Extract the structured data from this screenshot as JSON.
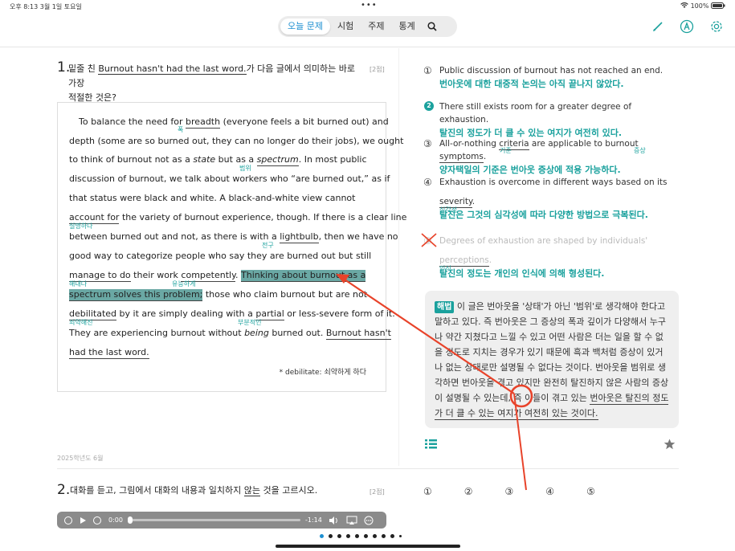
{
  "status": {
    "time": "오후 8:13   3월 1일 토요일",
    "dots": "•••",
    "battery": "100%"
  },
  "tabs": [
    "오늘 문제",
    "시험",
    "주제",
    "통계"
  ],
  "q1": {
    "num": "1.",
    "text_a": "밑줄 친 ",
    "text_u": "Burnout hasn't had the last word.",
    "text_b": "가 다음 글에서 의미하는 바로 가장",
    "text_c": "적절한 것은?",
    "points": "[2점]"
  },
  "passage": {
    "l1a": "To balance the need for ",
    "l1u": "breadth",
    "l1b": " (everyone feels a bit burned out) and",
    "g1": "폭",
    "l2": "depth (some are so burned out, they can no longer do their jobs), we ought",
    "l3a": "to think of burnout not as a ",
    "l3i": "state",
    "l3b": " but as a ",
    "l3u": "spectrum",
    "l3c": ". In most public",
    "g3": "범위",
    "l4": "discussion of burnout, we talk about workers who “are burned out,” as if",
    "l5": "that status were black and white. A black-and-white view cannot",
    "l6u": "account for",
    "l6b": " the variety of burnout experience, though. If there is a clear line",
    "g6": "설명하다",
    "l7a": "between burned out and not, as there is with a ",
    "l7u": "lightbulb",
    "l7b": ", then we have no",
    "g7": "전구",
    "l8": "good way to categorize people who say they are burned out but still",
    "l9u": "manage to do",
    "l9b": " their work ",
    "l9u2": "competently",
    "l9c": ". ",
    "l9h": "Thinking about burnout as a",
    "g9a": "해내다",
    "g9b": "유능하게",
    "l10h": "spectrum solves this problem;",
    "l10b": " those who claim burnout but are not",
    "l11u": "debilitated",
    "l11b": " by it are simply dealing with a ",
    "l11u2": "partial",
    "l11c": " or less-severe form of it.",
    "g11a": "쇠약해진",
    "g11b": "부분적인",
    "l12a": "They are experiencing burnout without ",
    "l12i": "being",
    "l12b": " burned out. ",
    "l12u": "Burnout hasn't",
    "l13u": "had the last word.",
    "footnote": "* debilitate: 쇠약하게 하다"
  },
  "options": [
    {
      "num": "①",
      "en": "Public discussion of burnout has not reached an end.",
      "ko": "번아웃에 대한 대중적 논의는 아직 끝나지 않았다."
    },
    {
      "num": "2",
      "en": "There still exists room for a greater degree of exhaustion.",
      "ko": "탈진의 정도가 더 클 수 있는 여지가 여전히 있다."
    },
    {
      "num": "③",
      "en_a": "All-or-nothing ",
      "en_u": "criteria",
      "en_b": " are applicable to burnout ",
      "en_u2": "symptoms",
      "en_c": ".",
      "g_a": "기준",
      "g_b": "증상",
      "ko": "양자택일의 기준은 번아웃 증상에 적용 가능하다."
    },
    {
      "num": "④",
      "en_a": "Exhaustion is overcome in different ways based on its",
      "en_u": "severity",
      "en_b": ".",
      "g": "심각성",
      "ko": "탈진은 그것의 심각성에 따라 다양한 방법으로 극복된다."
    },
    {
      "num": "⑤",
      "en_a": "Degrees of exhaustion are shaped by individuals'",
      "en_u": "perceptions",
      "en_b": ".",
      "g": "인식",
      "ko": "탈진의 정도는 개인의 인식에 의해 형성된다."
    }
  ],
  "explanation": {
    "tag": "해법",
    "text": " 이 글은 번아웃을 '상태'가 아닌 '범위'로 생각해야 한다고 말하고 있다. 즉 번아웃은 그 증상의 폭과 깊이가 다양해서 누구나 약간 지쳤다고 느낄 수 있고 어떤 사람은 더는 일을 할 수 없을 정도로 지치는 경우가 있기 때문에 흑과 백처럼 증상이 있거나 없는 상태로만 설명될 수 없다는 것이다. 번아웃을 범위로 생각하면 번아웃을 겪고 있지만 완전히 탈진하지 않은 사람의 증상이 설명될 수 있는데, 즉 이들이 겪고 있는 ",
    "text_u": "번아웃은 탈진의 정도가 더 클 수 있는 여지가 여전히 있는 것이다."
  },
  "source": "2025학년도 6월",
  "q2": {
    "num": "2.",
    "text_a": "대화를 듣고, 그림에서 대화의 내용과 일치하지 ",
    "text_u": "않는",
    "text_b": " 것을 고르시오.",
    "points": "[2점]"
  },
  "choices": [
    "①",
    "②",
    "③",
    "④",
    "⑤"
  ],
  "audio": {
    "start": "0:00",
    "end": "-1:14"
  },
  "colors": {
    "accent": "#1aa19d",
    "tab_active": "#1d8fd1",
    "highlight": "#6aa8a4",
    "arrow": "#e8432a"
  }
}
